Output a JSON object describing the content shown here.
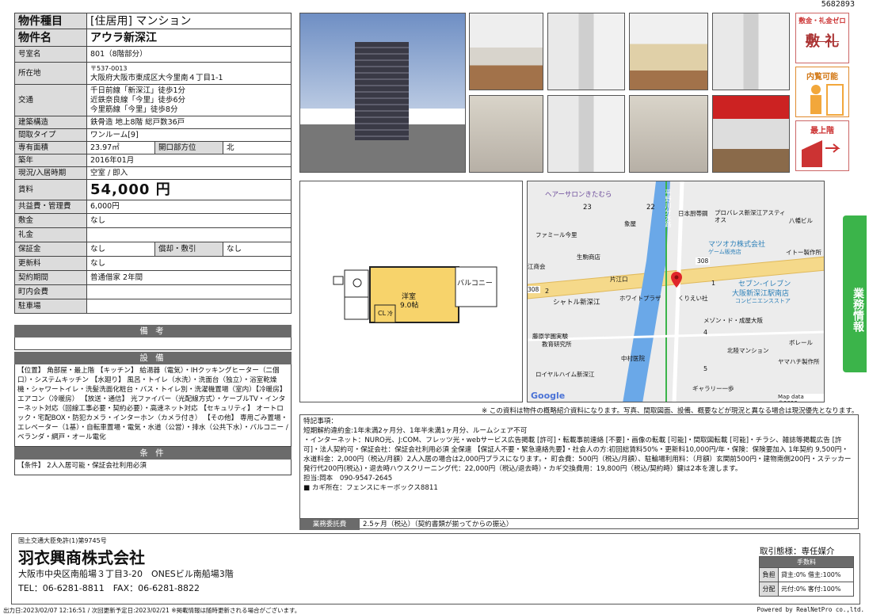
{
  "doc_id": "5682893",
  "property": {
    "type_label": "物件種目",
    "type_value": "[住居用] マンション",
    "name_label": "物件名",
    "name_value": "アウラ新深江",
    "room_label": "号室名",
    "room_value": "801（8階部分）",
    "addr_label": "所在地",
    "postal": "〒537-0013",
    "address": "大阪府大阪市東成区大今里南４丁目1-1",
    "access_label": "交通",
    "access": [
      "千日前線「新深江」徒歩1分",
      "近鉄奈良線「今里」徒歩6分",
      "今里筋線「今里」徒歩8分"
    ],
    "structure_label": "建築構造",
    "structure_value": "鉄骨造 地上8階 総戸数36戸",
    "layout_label": "間取タイプ",
    "layout_value": "ワンルーム[9]",
    "area_label": "専有面積",
    "area_value": "23.97㎡",
    "opening_label": "開口部方位",
    "opening_value": "北",
    "built_label": "築年",
    "built_value": "2016年01月",
    "status_label": "現況/入居時期",
    "status_value": "空室 / 即入",
    "rent_label": "賃料",
    "rent_value": "54,000 円",
    "common_label": "共益費・管理費",
    "common_value": "6,000円",
    "deposit_label": "敷金",
    "deposit_value": "なし",
    "keymoney_label": "礼金",
    "keymoney_value": "",
    "hosho_label": "保証金",
    "hosho_value": "なし",
    "shokyaku_label": "償却・敷引",
    "shokyaku_value": "なし",
    "renewal_label": "更新料",
    "renewal_value": "なし",
    "contract_label": "契約期間",
    "contract_value": "普通借家 2年間",
    "neighborhood_label": "町内会費",
    "neighborhood_value": "",
    "parking_label": "駐車場",
    "parking_value": ""
  },
  "sections": {
    "biko": "備 考",
    "setsubi": "設 備",
    "setsubi_text": "【位置】 角部屋・最上階 【キッチン】 給湯器（電気）・IHクッキングヒーター（二個口）・システムキッチン 【水廻り】 風呂・トイレ（水洗）・洗面台（独立）・浴室乾燥機・シャワートイレ・洗髪洗面化粧台・バス・トイレ別・洗濯機置場（室内）【冷暖房】 エアコン（冷暖房） 【放送・通信】 光ファイバー（光配線方式）・ケーブルTV・インターネット対応（回線工事必要・契約必要）・高速ネット対応 【セキュリティ】 オートロック・宅配BOX・防犯カメラ・インターホン（カメラ付き） 【その他】 専用ごみ置場・エレベーター（1基）・自転車置場・電気・水道（公営）・排水（公共下水）・バルコニー / ベランダ・網戸・オール電化",
    "joken": "条 件",
    "joken_text": "【条件】 2人入居可能・保証会社利用必須"
  },
  "badges": {
    "zero": "敷金・礼金ゼロ",
    "zero_sub": "敷 礼",
    "naiken": "内覧可能",
    "top": "最上階"
  },
  "floorplan": {
    "room": "洋室",
    "size": "9.0帖",
    "balcony": "バルコニー",
    "cl": "CL",
    "misc": "冷"
  },
  "map": {
    "labels": [
      "ヘアーサロンきたむら",
      "23",
      "22",
      "日本厨帯鋼",
      "プロバレス新深江アスティオス",
      "八幡ビル",
      "ファミール今里",
      "象屋",
      "平野川分水路",
      "マツオカ株式会社",
      "ゲーム販売店",
      "イトー製作所",
      "生駒商店",
      "江商会",
      "308",
      "308",
      "片江口",
      "1",
      "セブン-イレブン",
      "大阪新深江駅南店",
      "コンビニエンスストア",
      "2",
      "シャトル新深江",
      "ホワイトプラザ",
      "くりえい社",
      "メゾン・ド・成屋大阪",
      "4",
      "藤原学園実験",
      "教育研究所",
      "中村医院",
      "北陸マンション",
      "ボレール",
      "ヤマハチ製作所",
      "ロイヤルハイム新深江",
      "5",
      "ギャラリー一歩",
      "Google",
      "Map data ©2023"
    ]
  },
  "disclaimer": "※ この資料は物件の概略紹介資料になります。写真、間取図面、設備、概要などが現況と異なる場合は現況優先となります。",
  "notes": {
    "title": "特記事項：",
    "lines": [
      "短期解約違約金:1年未満2ヶ月分、1年半未満1ヶ月分、ルームシェア不可",
      "・インターネット：NURO光、J:COM、フレッツ光・webサービス広告掲載 [許可]・転載事前連絡 [不要]・画像の転載 [可能]・間取図転載 [可能]・チラシ、雑誌等掲載広告 [許可]・法人契約可・保証会社：保証会社利用必須 全保連 【保証人不要・緊急連絡先要】・社会人の方:初回総賃料50%・更新料10,000円/年・保険：保険要加入 1年契約 9,500円・水道料金：2,000円（税込/月額）2人入居の場合は2,000円プラスになります。・ 町会費：500円（税込/月額）、駐輪場利用料：（月額）玄関前500円・建物南側200円・ステッカー発行代200円(税込)・退去時ハウスクリーニング代：22,000円（税込/退去時）・カギ交換費用：19,800円（税込/契約時）鍵は2本を渡します。",
      "担当:岡本　090-9547-2645",
      "■ カギ所在：フェンスにキーボックス8811"
    ],
    "fee_label": "業務委託費",
    "fee_value": "2.5ヶ月（税込）（契約書類が揃ってからの振込）"
  },
  "gyomu_tab": "業務情報",
  "company": {
    "license": "国土交通大臣免許(1)第9745号",
    "name": "羽衣興商株式会社",
    "address": "大阪市中央区南船場３丁目3-20　ONESビル南船場3階",
    "tel": "TEL：06-6281-8811　FAX：06-6281-8822",
    "deal_type": "取引態様：専任媒介",
    "fee_header": "手数料",
    "futan": "負担",
    "futan_val": "貸主:0% 借主:100%",
    "bunpai": "分配",
    "bunpai_val": "元付:0% 客付:100%"
  },
  "bottom": {
    "left": "出力日:2023/02/07 12:16:51 / 次回更新予定日:2023/02/21 ※掲載情報は随時更新される場合がございます。",
    "right": "Powered by RealNetPro co.,ltd."
  }
}
